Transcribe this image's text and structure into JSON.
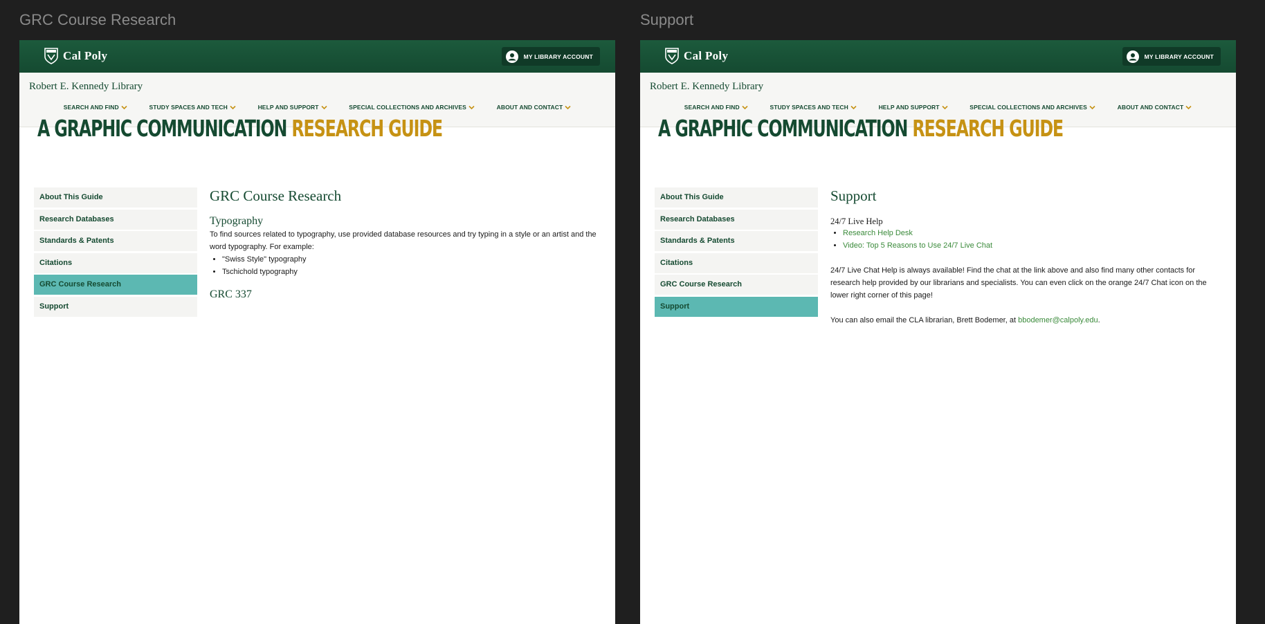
{
  "frames": {
    "left": {
      "title": "GRC Course Research"
    },
    "right": {
      "title": "Support"
    }
  },
  "header": {
    "logo_text": "Cal Poly",
    "account_button": "MY LIBRARY ACCOUNT",
    "library_name": "Robert E. Kennedy Library",
    "nav": [
      {
        "label": "SEARCH AND FIND"
      },
      {
        "label": "STUDY SPACES AND TECH"
      },
      {
        "label": "HELP AND SUPPORT"
      },
      {
        "label": "SPECIAL COLLECTIONS AND ARCHIVES"
      },
      {
        "label": "ABOUT AND CONTACT"
      }
    ]
  },
  "guide": {
    "title_part1": "A GRAPHIC COMMUNICATION",
    "title_part2": "RESEARCH GUIDE"
  },
  "sidebar": {
    "items": [
      {
        "label": "About This Guide"
      },
      {
        "label": "Research Databases"
      },
      {
        "label": "Standards & Patents"
      },
      {
        "label": "Citations"
      },
      {
        "label": "GRC Course Research"
      },
      {
        "label": "Support"
      }
    ],
    "active_left": "GRC Course Research",
    "active_right": "Support"
  },
  "grc_page": {
    "title": "GRC Course Research",
    "section1_heading": "Typography",
    "section1_text": "To find sources related to typography, use provided database resources and try typing in a style or an artist and the word typography. For example:",
    "section1_examples": [
      "\"Swiss Style\" typography",
      "Tschichold typography"
    ],
    "section2_heading": "GRC 337"
  },
  "support_page": {
    "title": "Support",
    "live_help_heading": "24/7 Live Help",
    "links": [
      "Research Help Desk",
      "Video: Top 5 Reasons to Use 24/7 Live Chat"
    ],
    "paragraph1": "24/7 Live Chat Help is always available! Find the chat at the link above and also find many other contacts for research help provided by our librarians and specialists. You can even click on the orange 24/7 Chat icon on the lower right corner of this page!",
    "paragraph2_prefix": "You can also email the CLA librarian, Brett Bodemer, at ",
    "email": "bbodemer@calpoly.edu",
    "paragraph2_suffix": "."
  },
  "colors": {
    "brand_green": "#154a31",
    "gold": "#c69214",
    "active_teal": "#5cb8b2",
    "link_green": "#3a8a3a"
  },
  "icons": {
    "logo": "shield-icon",
    "account": "user-icon",
    "nav_chevron": "chevron-down-icon"
  }
}
